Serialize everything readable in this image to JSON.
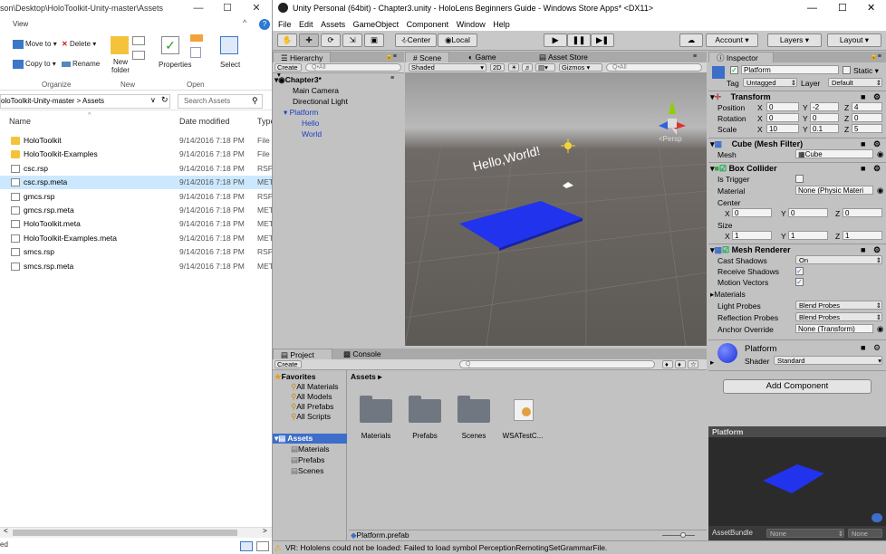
{
  "explorer": {
    "title": "son\\Desktop\\HoloToolkit-Unity-master\\Assets",
    "view_tab": "View",
    "ribbon": {
      "move_to": "Move to",
      "delete": "Delete",
      "copy_to": "Copy to",
      "rename": "Rename",
      "new_folder": "New folder",
      "properties": "Properties",
      "select": "Select",
      "group_organize": "Organize",
      "group_new": "New",
      "group_open": "Open"
    },
    "address": "oloToolkit-Unity-master  >  Assets",
    "search_placeholder": "Search Assets",
    "columns": {
      "name": "Name",
      "date": "Date modified",
      "type": "Type"
    },
    "files": [
      {
        "name": "HoloToolkit",
        "date": "9/14/2016 7:18 PM",
        "type": "File f",
        "icon": "folder-icon"
      },
      {
        "name": "HoloToolkit-Examples",
        "date": "9/14/2016 7:18 PM",
        "type": "File f",
        "icon": "folder-icon"
      },
      {
        "name": "csc.rsp",
        "date": "9/14/2016 7:18 PM",
        "type": "RSP F",
        "icon": "file-icon"
      },
      {
        "name": "csc.rsp.meta",
        "date": "9/14/2016 7:18 PM",
        "type": "META",
        "icon": "file-icon"
      },
      {
        "name": "gmcs.rsp",
        "date": "9/14/2016 7:18 PM",
        "type": "RSP F",
        "icon": "file-icon"
      },
      {
        "name": "gmcs.rsp.meta",
        "date": "9/14/2016 7:18 PM",
        "type": "META",
        "icon": "file-icon"
      },
      {
        "name": "HoloToolkit.meta",
        "date": "9/14/2016 7:18 PM",
        "type": "META",
        "icon": "file-icon"
      },
      {
        "name": "HoloToolkit-Examples.meta",
        "date": "9/14/2016 7:18 PM",
        "type": "META",
        "icon": "file-icon"
      },
      {
        "name": "smcs.rsp",
        "date": "9/14/2016 7:18 PM",
        "type": "RSP F",
        "icon": "file-icon"
      },
      {
        "name": "smcs.rsp.meta",
        "date": "9/14/2016 7:18 PM",
        "type": "META",
        "icon": "file-icon"
      }
    ],
    "status": "ed"
  },
  "unity": {
    "title": "Unity Personal (64bit) - Chapter3.unity - HoloLens Beginners Guide - Windows Store Apps* <DX11>",
    "menu": [
      "File",
      "Edit",
      "Assets",
      "GameObject",
      "Component",
      "Window",
      "Help"
    ],
    "toolbar": {
      "center": "Center",
      "local": "Local",
      "account": "Account",
      "layers": "Layers",
      "layout": "Layout"
    },
    "hierarchy": {
      "tab": "Hierarchy",
      "create": "Create",
      "search": "Q•All",
      "scene": "Chapter3*",
      "items": [
        "Main Camera",
        "Directional Light",
        "Platform",
        "Hello",
        "World"
      ]
    },
    "scene": {
      "tabs": [
        "Scene",
        "Game",
        "Asset Store"
      ],
      "shaded": "Shaded",
      "mode_2d": "2D",
      "gizmos": "Gizmos",
      "search": "Q•All",
      "persp": "Persp",
      "hello_text": "Hello,World!"
    },
    "project": {
      "tabs": [
        "Project",
        "Console"
      ],
      "create": "Create",
      "favorites": "Favorites",
      "favorite_items": [
        "All Materials",
        "All Models",
        "All Prefabs",
        "All Scripts"
      ],
      "assets_root": "Assets",
      "asset_folders": [
        "Materials",
        "Prefabs",
        "Scenes"
      ],
      "breadcrumb": "Assets",
      "grid_items": [
        "Materials",
        "Prefabs",
        "Scenes",
        "WSATestC..."
      ],
      "selected_file": "Platform.prefab"
    },
    "inspector": {
      "tab": "Inspector",
      "object_name": "Platform",
      "static": "Static",
      "tag_label": "Tag",
      "tag_value": "Untagged",
      "layer_label": "Layer",
      "layer_value": "Default",
      "transform": {
        "title": "Transform",
        "position": {
          "label": "Position",
          "x": "0",
          "y": "-2",
          "z": "4"
        },
        "rotation": {
          "label": "Rotation",
          "x": "0",
          "y": "0",
          "z": "0"
        },
        "scale": {
          "label": "Scale",
          "x": "10",
          "y": "0.1",
          "z": "5"
        }
      },
      "mesh_filter": {
        "title": "Cube (Mesh Filter)",
        "mesh_label": "Mesh",
        "mesh_value": "Cube"
      },
      "box_collider": {
        "title": "Box Collider",
        "is_trigger": "Is Trigger",
        "material_label": "Material",
        "material_value": "None (Physic Materi",
        "center": "Center",
        "center_x": "0",
        "center_y": "0",
        "center_z": "0",
        "size": "Size",
        "size_x": "1",
        "size_y": "1",
        "size_z": "1"
      },
      "mesh_renderer": {
        "title": "Mesh Renderer",
        "cast_shadows": "Cast Shadows",
        "cast_shadows_value": "On",
        "receive_shadows": "Receive Shadows",
        "motion_vectors": "Motion Vectors",
        "materials": "Materials",
        "light_probes": "Light Probes",
        "light_probes_value": "Blend Probes",
        "reflection_probes": "Reflection Probes",
        "reflection_probes_value": "Blend Probes",
        "anchor_override": "Anchor Override",
        "anchor_override_value": "None (Transform)"
      },
      "material": {
        "name": "Platform",
        "shader_label": "Shader",
        "shader_value": "Standard"
      },
      "add_component": "Add Component",
      "preview_title": "Platform",
      "asset_bundle": "AssetBundle",
      "asset_bundle_value": "None",
      "asset_bundle_variant": "None"
    },
    "status": "VR: Hololens could not be loaded: Failed to load symbol PerceptionRemotingSetGrammarFile.",
    "colors": {
      "accent": "#2a5bd7",
      "platform": "#2233ee",
      "selection": "#3d6ec9"
    }
  }
}
